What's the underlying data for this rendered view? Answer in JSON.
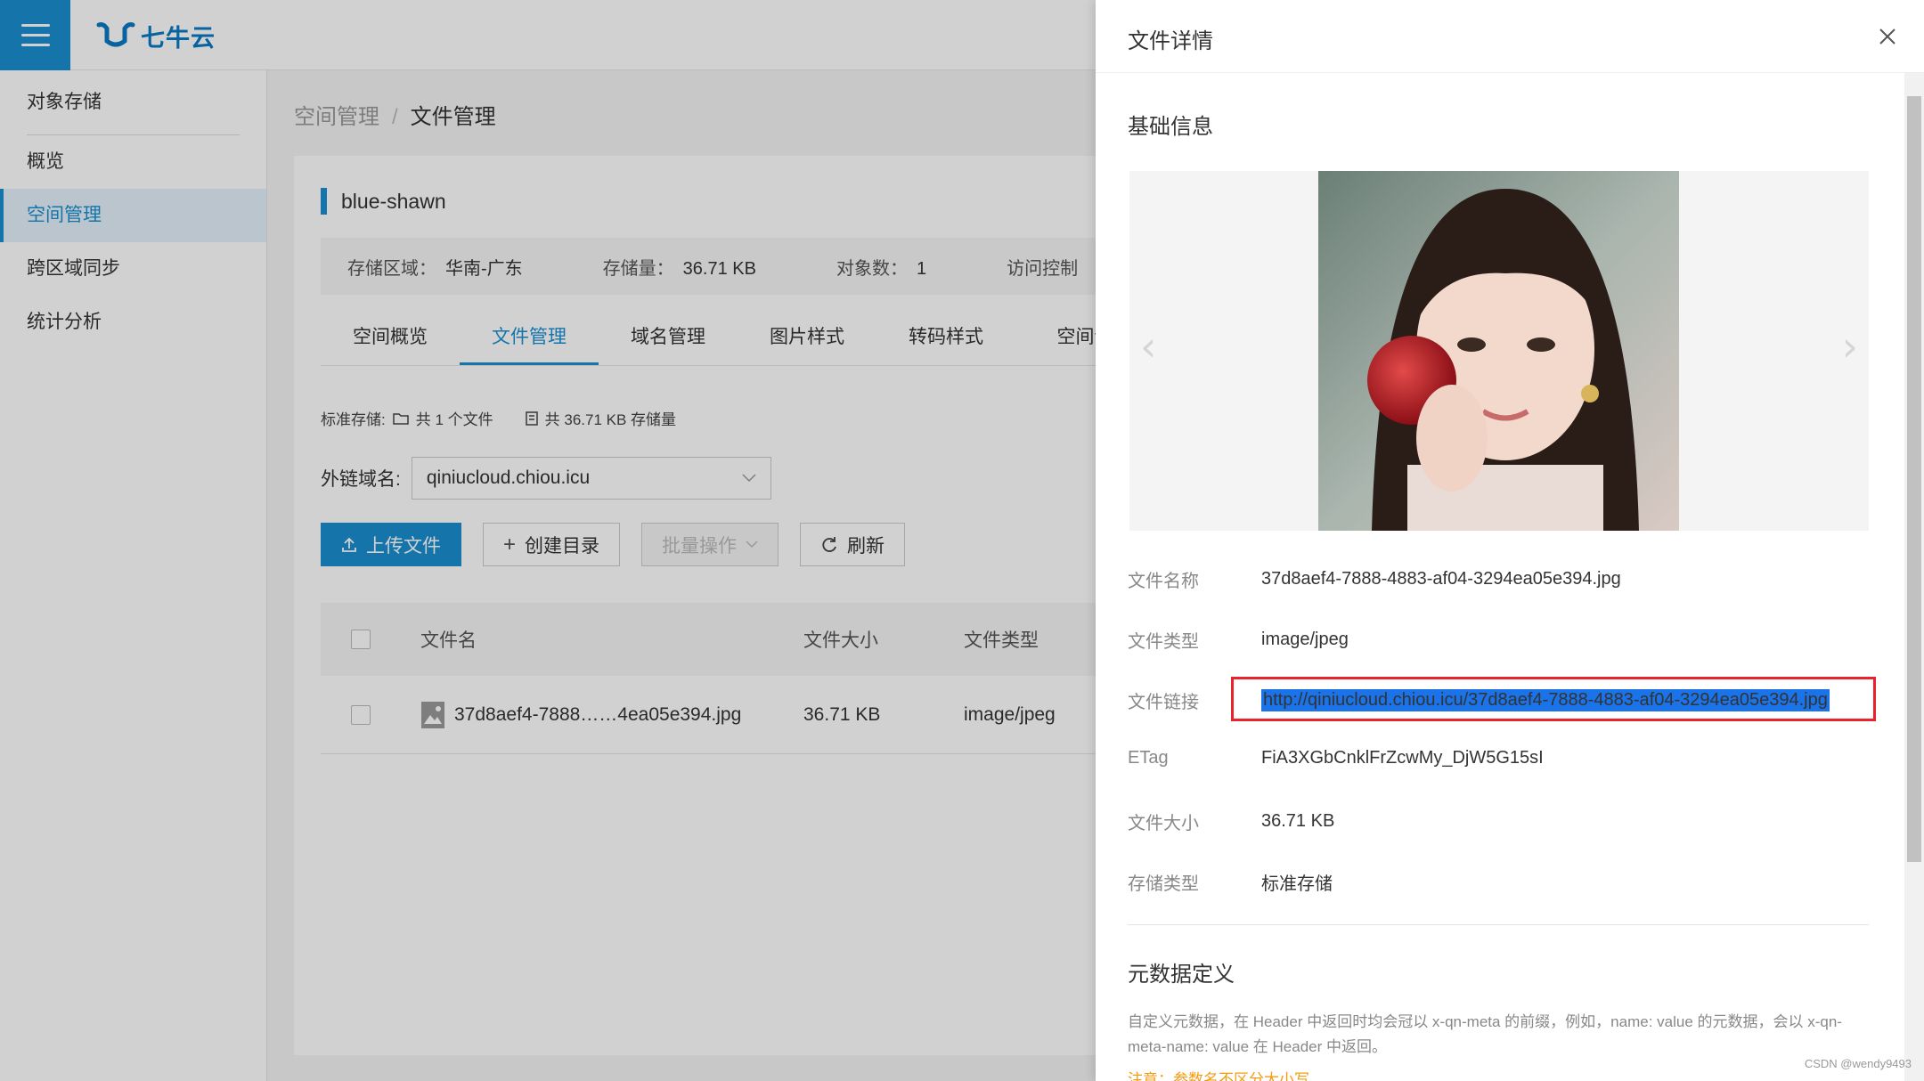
{
  "topbar": {
    "logo_text": "七牛云"
  },
  "sidebar": {
    "header": "对象存储",
    "items": [
      {
        "label": "概览"
      },
      {
        "label": "空间管理"
      },
      {
        "label": "跨区域同步"
      },
      {
        "label": "统计分析"
      }
    ]
  },
  "breadcrumb": {
    "parent": "空间管理",
    "separator": "/",
    "current": "文件管理"
  },
  "bucket": {
    "name": "blue-shawn",
    "region_label": "存储区域：",
    "region_value": "华南-广东",
    "storage_label": "存储量：",
    "storage_value": "36.71 KB",
    "objects_label": "对象数：",
    "objects_value": "1",
    "access_label": "访问控制"
  },
  "tabs": [
    {
      "label": "空间概览"
    },
    {
      "label": "文件管理"
    },
    {
      "label": "域名管理"
    },
    {
      "label": "图片样式"
    },
    {
      "label": "转码样式"
    },
    {
      "label": "空间设"
    }
  ],
  "summary": {
    "prefix": "标准存储:",
    "files": "共 1 个文件",
    "storage": "共 36.71 KB 存储量"
  },
  "domain": {
    "label": "外链域名:",
    "value": "qiniucloud.chiou.icu"
  },
  "buttons": {
    "upload": "上传文件",
    "mkdir": "创建目录",
    "batch": "批量操作",
    "refresh": "刷新"
  },
  "table": {
    "headers": {
      "name": "文件名",
      "size": "文件大小",
      "type": "文件类型"
    },
    "rows": [
      {
        "name": "37d8aef4-7888……4ea05e394.jpg",
        "size": "36.71 KB",
        "type": "image/jpeg"
      }
    ]
  },
  "drawer": {
    "title": "文件详情",
    "basic_title": "基础信息",
    "fields": {
      "name_label": "文件名称",
      "name_value": "37d8aef4-7888-4883-af04-3294ea05e394.jpg",
      "type_label": "文件类型",
      "type_value": "image/jpeg",
      "link_label": "文件链接",
      "link_value": "http://qiniucloud.chiou.icu/37d8aef4-7888-4883-af04-3294ea05e394.jpg",
      "etag_label": "ETag",
      "etag_value": "FiA3XGbCnklFrZcwMy_DjW5G15sI",
      "size_label": "文件大小",
      "size_value": "36.71 KB",
      "storage_label": "存储类型",
      "storage_value": "标准存储"
    },
    "meta_title": "元数据定义",
    "meta_desc": "自定义元数据，在 Header 中返回时均会冠以 x-qn-meta 的前缀，例如，name: value 的元数据，会以 x-qn-meta-name: value 在 Header 中返回。",
    "meta_note": "注意：参数名不区分大小写"
  },
  "watermark": "CSDN @wendy9493",
  "colors": {
    "accent": "#1a8fd1",
    "highlight_border": "#e8232c",
    "selection": "#1a73e8"
  }
}
